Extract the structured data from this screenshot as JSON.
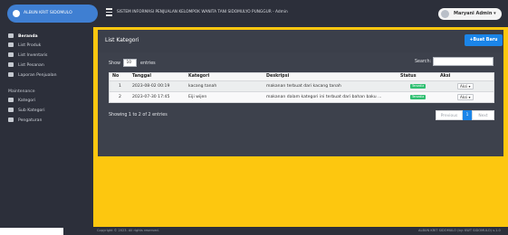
{
  "brand": {
    "label": "ALBUN KRIT SIDOMULO"
  },
  "header": {
    "title": "SISTEM INFORMASI PENJUALAN KELOMPOK WANITA TANI SIDOMULYO PUNGGUR - Admin",
    "user": "Maryani Admin"
  },
  "sidebar": {
    "items": [
      {
        "label": "Beranda",
        "icon": "dashboard-icon"
      },
      {
        "label": "List Produk",
        "icon": "box-icon"
      },
      {
        "label": "List Inventaris",
        "icon": "inventory-icon"
      },
      {
        "label": "List Pesanan",
        "icon": "list-icon"
      },
      {
        "label": "Laporan Penjualan",
        "icon": "report-icon"
      }
    ],
    "section_header": "Maintenance",
    "maintenance_items": [
      {
        "label": "Kategori",
        "icon": "tag-icon"
      },
      {
        "label": "Sub Kategori",
        "icon": "list-icon"
      },
      {
        "label": "Pengaturan",
        "icon": "gear-icon"
      }
    ]
  },
  "panel": {
    "title": "List Kategori",
    "new_button": "Buat Baru",
    "show_label": "Show",
    "entries_value": "10",
    "entries_label": "entries",
    "search_label": "Search:"
  },
  "table": {
    "headers": [
      "No",
      "Tanggal",
      "Kategori",
      "Deskripsi",
      "Status",
      "Aksi"
    ],
    "rows": [
      {
        "no": "1",
        "tanggal": "2023-08-02 00:19",
        "kategori": "kacang tanah",
        "deskripsi": "makanan terbuat dari kacang tanah",
        "status": "Tersedia",
        "aksi": "Aksi"
      },
      {
        "no": "2",
        "tanggal": "2023-07-30 17:45",
        "kategori": "Eiji wijen",
        "deskripsi": "makanan dalam kategori ini terbuat dari bahan baku ...",
        "status": "Tersedia",
        "aksi": "Aksi"
      }
    ]
  },
  "pagination": {
    "info": "Showing 1 to 2 of 2 entries",
    "previous": "Previous",
    "current": "1",
    "next": "Next"
  },
  "footer": {
    "left": "Copyright © 2023. All rights reserved.",
    "right": "ALBUN KRIT SIDOMULO (by: KWT SIDOMULO) v.1.0"
  },
  "colors": {
    "main_background": "#fdc70f",
    "sidebar": "#2c2f3a",
    "primary_button": "#1b85e8",
    "status_badge": "#2fbf71"
  }
}
